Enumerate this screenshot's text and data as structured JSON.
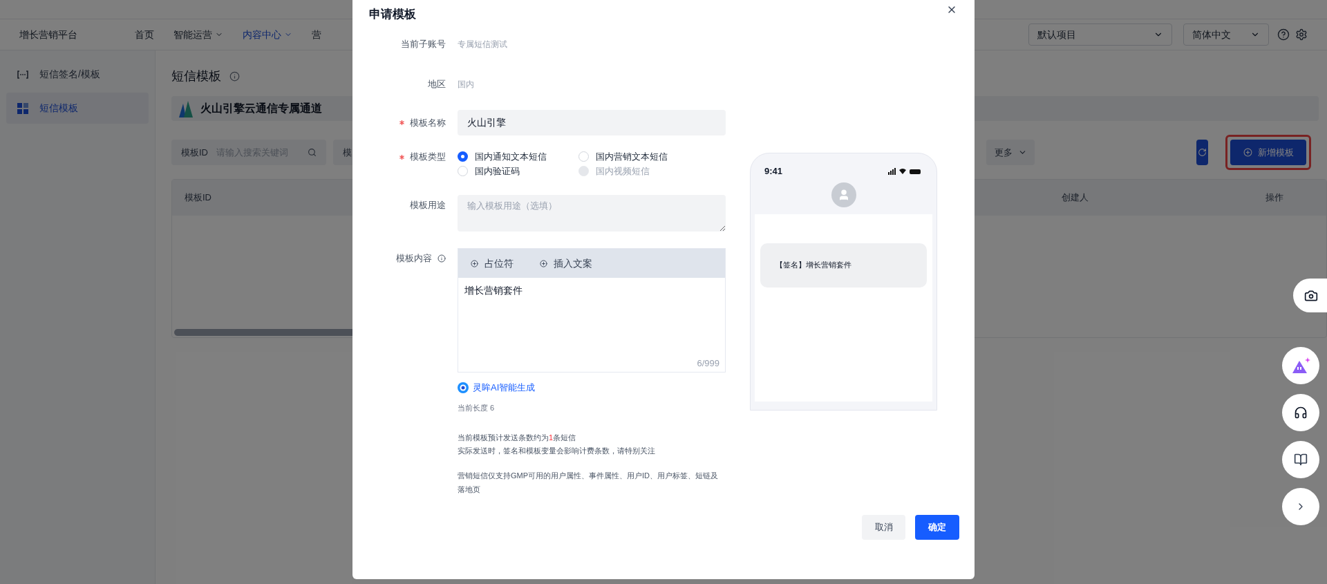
{
  "top_nav": {
    "brand": "增长营销平台",
    "items": [
      {
        "label": "首页",
        "selected": false,
        "caret": false
      },
      {
        "label": "智能运营",
        "selected": false,
        "caret": true
      },
      {
        "label": "内容中心",
        "selected": true,
        "caret": true
      },
      {
        "label": "营",
        "selected": false,
        "caret": false
      }
    ],
    "project_select": "默认项目",
    "language_select": "简体中文"
  },
  "sidebar": {
    "items": [
      {
        "label": "短信签名/模板",
        "selected": false,
        "kind": "brackets"
      },
      {
        "label": "短信模板",
        "selected": true,
        "kind": "grid"
      }
    ]
  },
  "main": {
    "title": "短信模板",
    "channel": "火山引擎云通信专属通道",
    "filters": [
      {
        "label": "模板ID",
        "placeholder": "请输入搜索关键词"
      },
      {
        "label": "模"
      }
    ],
    "more_button": "更多",
    "add_button": "新增模板",
    "add_button_highlighted": true,
    "table": {
      "columns": [
        "模板ID",
        "创建人",
        "操作"
      ]
    }
  },
  "modal": {
    "title": "申请模板",
    "account": {
      "label": "当前子账号",
      "value": "专属短信测试"
    },
    "region": {
      "label": "地区",
      "value": "国内"
    },
    "name": {
      "label": "模板名称",
      "required": true,
      "value": "火山引擎"
    },
    "type": {
      "label": "模板类型",
      "required": true,
      "options": [
        {
          "label": "国内通知文本短信",
          "selected": true,
          "disabled": false
        },
        {
          "label": "国内营销文本短信",
          "selected": false,
          "disabled": false
        },
        {
          "label": "国内验证码",
          "selected": false,
          "disabled": false
        },
        {
          "label": "国内视频短信",
          "selected": false,
          "disabled": true
        }
      ]
    },
    "purpose": {
      "label": "模板用途",
      "placeholder": "输入模板用途（选填）"
    },
    "content": {
      "label": "模板内容",
      "tools": [
        "占位符",
        "插入文案"
      ],
      "value": "增长营销套件",
      "counter": "6/999"
    },
    "ai_link": "灵眸AI智能生成",
    "length": "当前长度 6",
    "estimate": {
      "prefix": "当前模板预计发送条数约为",
      "count": "1",
      "suffix": "条短信"
    },
    "notes": [
      "实际发送时，签名和模板变量会影响计费条数，请特别关注",
      "营销短信仅支持GMP可用的用户属性、事件属性、用户ID、用户标签、短链及落地页"
    ],
    "preview": {
      "time": "9:41",
      "message": "【签名】增长营销套件"
    },
    "buttons": {
      "cancel": "取消",
      "confirm": "确定"
    }
  }
}
